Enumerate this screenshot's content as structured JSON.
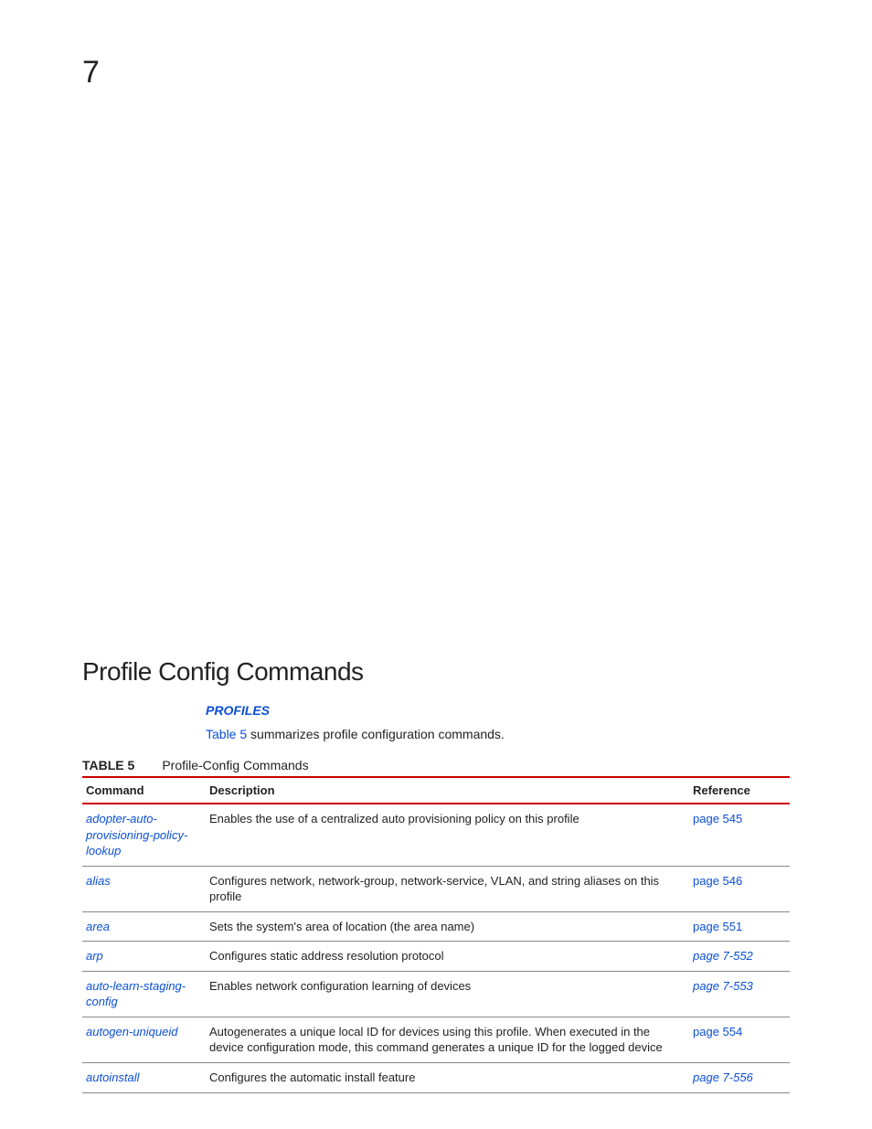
{
  "chapter_number": "7",
  "section_title": "Profile Config Commands",
  "profiles_link": "PROFILES",
  "summary_prefix": "Table 5",
  "summary_rest": " summarizes profile configuration commands.",
  "table_label": "TABLE 5",
  "table_caption": "Profile-Config Commands",
  "headers": {
    "command": "Command",
    "description": "Description",
    "reference": "Reference"
  },
  "rows": [
    {
      "command": "adopter-auto-provisioning-policy-lookup",
      "description": "Enables the use of a centralized auto provisioning policy on this profile",
      "reference": "page 545",
      "ref_italic": false
    },
    {
      "command": "alias",
      "description": "Configures network, network-group, network-service, VLAN, and string aliases on this profile",
      "reference": "page 546",
      "ref_italic": false
    },
    {
      "command": "area",
      "description": "Sets the system's area of location (the area name)",
      "reference": "page 551",
      "ref_italic": false
    },
    {
      "command": "arp",
      "description": "Configures static address resolution protocol",
      "reference": "page 7-552",
      "ref_italic": true
    },
    {
      "command": "auto-learn-staging-config",
      "description": "Enables network configuration learning of devices",
      "reference": "page 7-553",
      "ref_italic": true
    },
    {
      "command": "autogen-uniqueid",
      "description": "Autogenerates a unique local ID for devices using this profile. When executed in the device configuration mode, this command generates a unique ID for the logged device",
      "reference": "page 554",
      "ref_italic": false
    },
    {
      "command": "autoinstall",
      "description": "Configures the automatic install feature",
      "reference": "page 7-556",
      "ref_italic": true
    }
  ]
}
